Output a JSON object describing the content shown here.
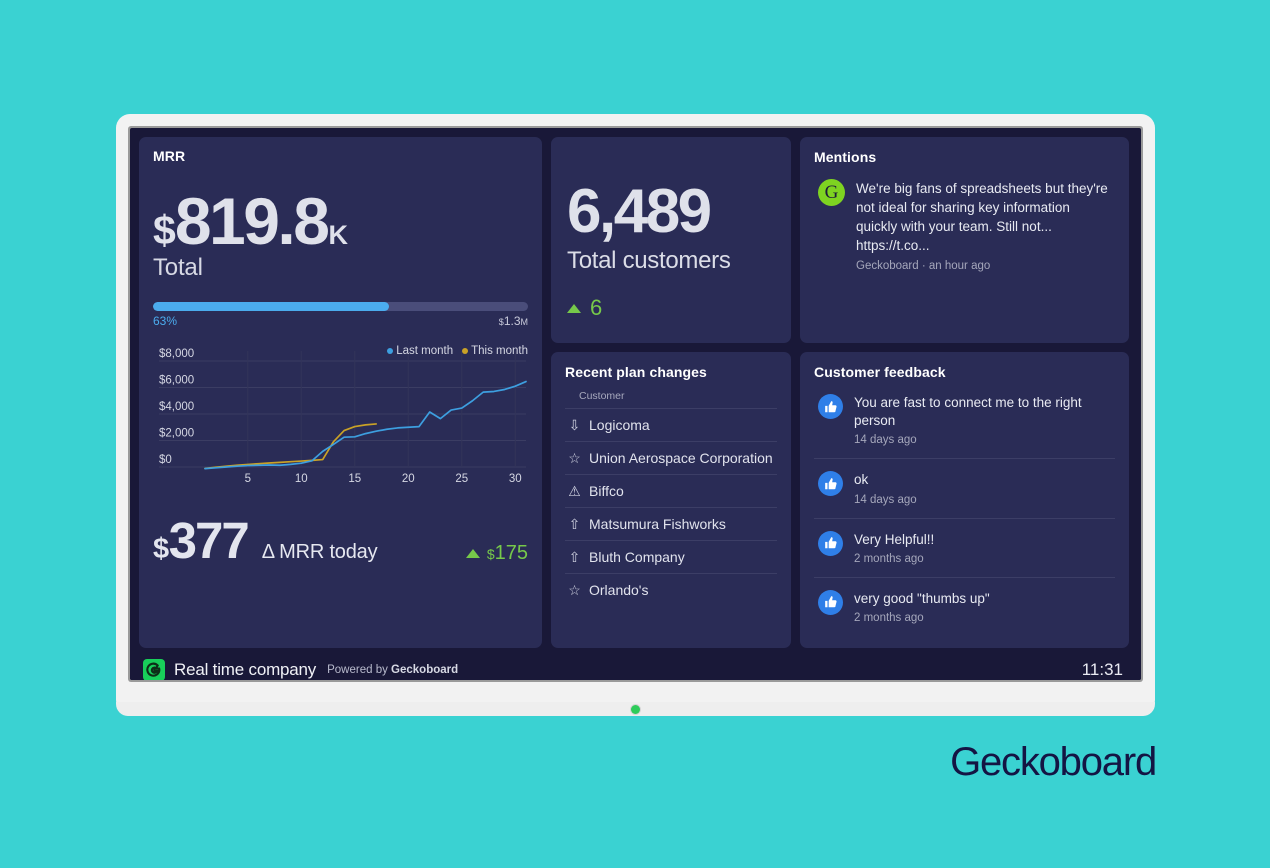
{
  "brand": {
    "wordmark": "Geckoboard",
    "footer_company": "Real time company",
    "footer_powered_prefix": "Powered by ",
    "footer_powered_brand": "Geckoboard",
    "clock": "11:31",
    "logo_icon": "gecko-logo-icon",
    "accent_teal": "#3AD2D2",
    "dark_navy": "#141544"
  },
  "mrr": {
    "title": "MRR",
    "currency": "$",
    "value": "819.8",
    "suffix": "K",
    "label": "Total",
    "progress_percent": "63%",
    "progress_fill": 63,
    "target_currency": "$",
    "target_value": "1.3",
    "target_unit": "M",
    "bar_fill_color": "#4bacee",
    "bar_track_color": "#4a4d7a"
  },
  "delta": {
    "currency": "$",
    "value": "377",
    "label": "Δ MRR today",
    "change_currency": "$",
    "change_value": "175",
    "change_icon": "triangle-up-icon",
    "change_color": "#76c94a"
  },
  "chart_data": {
    "type": "line",
    "title": "",
    "xlabel": "",
    "ylabel": "",
    "ylim": [
      0,
      8000
    ],
    "xlim": [
      1,
      31
    ],
    "grid": true,
    "legend_position": "top-right",
    "ytick_labels": [
      "$8,000",
      "$6,000",
      "$4,000",
      "$2,000",
      "$0"
    ],
    "ytick_values": [
      8000,
      6000,
      4000,
      2000,
      0
    ],
    "xtick_labels": [
      "5",
      "10",
      "15",
      "20",
      "25",
      "30"
    ],
    "xtick_values": [
      5,
      10,
      15,
      20,
      25,
      30
    ],
    "series": [
      {
        "name": "Last month",
        "color": "#3d9fe0",
        "x": [
          1,
          2,
          3,
          4,
          5,
          6,
          7,
          8,
          9,
          10,
          11,
          12,
          13,
          14,
          15,
          16,
          17,
          18,
          19,
          20,
          21,
          22,
          23,
          24,
          25,
          26,
          27,
          28,
          29,
          30,
          31
        ],
        "values": [
          -120,
          -60,
          0,
          60,
          110,
          130,
          150,
          130,
          200,
          290,
          470,
          1180,
          1700,
          2250,
          2280,
          2520,
          2700,
          2850,
          2950,
          3000,
          3050,
          4150,
          3650,
          4300,
          4450,
          5000,
          5650,
          5700,
          5850,
          6100,
          6450
        ]
      },
      {
        "name": "This month",
        "color": "#c9a227",
        "x": [
          1,
          2,
          3,
          4,
          5,
          6,
          7,
          8,
          9,
          10,
          11,
          12,
          13,
          14,
          15,
          16,
          17
        ],
        "values": [
          -110,
          -20,
          60,
          130,
          190,
          250,
          300,
          350,
          400,
          450,
          500,
          560,
          1900,
          2750,
          3050,
          3180,
          3250
        ]
      }
    ]
  },
  "customers": {
    "value": "6,489",
    "label": "Total customers",
    "change_value": "6",
    "change_icon": "triangle-up-icon",
    "change_color": "#76c94a"
  },
  "plan_changes": {
    "title": "Recent plan changes",
    "column_header": "Customer",
    "rows": [
      {
        "icon": "arrow-down-icon",
        "glyph": "⇩",
        "name": "Logicoma"
      },
      {
        "icon": "star-icon",
        "glyph": "☆",
        "name": "Union Aerospace Corporation"
      },
      {
        "icon": "warning-icon",
        "glyph": "⚠",
        "name": "Biffco"
      },
      {
        "icon": "arrow-up-icon",
        "glyph": "⇧",
        "name": "Matsumura Fishworks"
      },
      {
        "icon": "arrow-up-icon",
        "glyph": "⇧",
        "name": "Bluth Company"
      },
      {
        "icon": "star-icon",
        "glyph": "☆",
        "name": "Orlando's"
      }
    ]
  },
  "mentions": {
    "title": "Mentions",
    "items": [
      {
        "avatar_icon": "geckoboard-avatar-icon",
        "avatar_letter": "G",
        "text": "We're big fans of spreadsheets but they're not ideal for sharing key information quickly with your team. Still not... https://t.co...",
        "meta": "Geckoboard · an hour ago"
      }
    ]
  },
  "feedback": {
    "title": "Customer feedback",
    "items": [
      {
        "icon": "thumbs-up-icon",
        "text": "You are fast to connect me to the right person",
        "time": "14 days ago"
      },
      {
        "icon": "thumbs-up-icon",
        "text": "ok",
        "time": "14 days ago"
      },
      {
        "icon": "thumbs-up-icon",
        "text": "Very Helpful!!",
        "time": "2 months ago"
      },
      {
        "icon": "thumbs-up-icon",
        "text": "very good \"thumbs up\"",
        "time": "2 months ago"
      }
    ]
  }
}
